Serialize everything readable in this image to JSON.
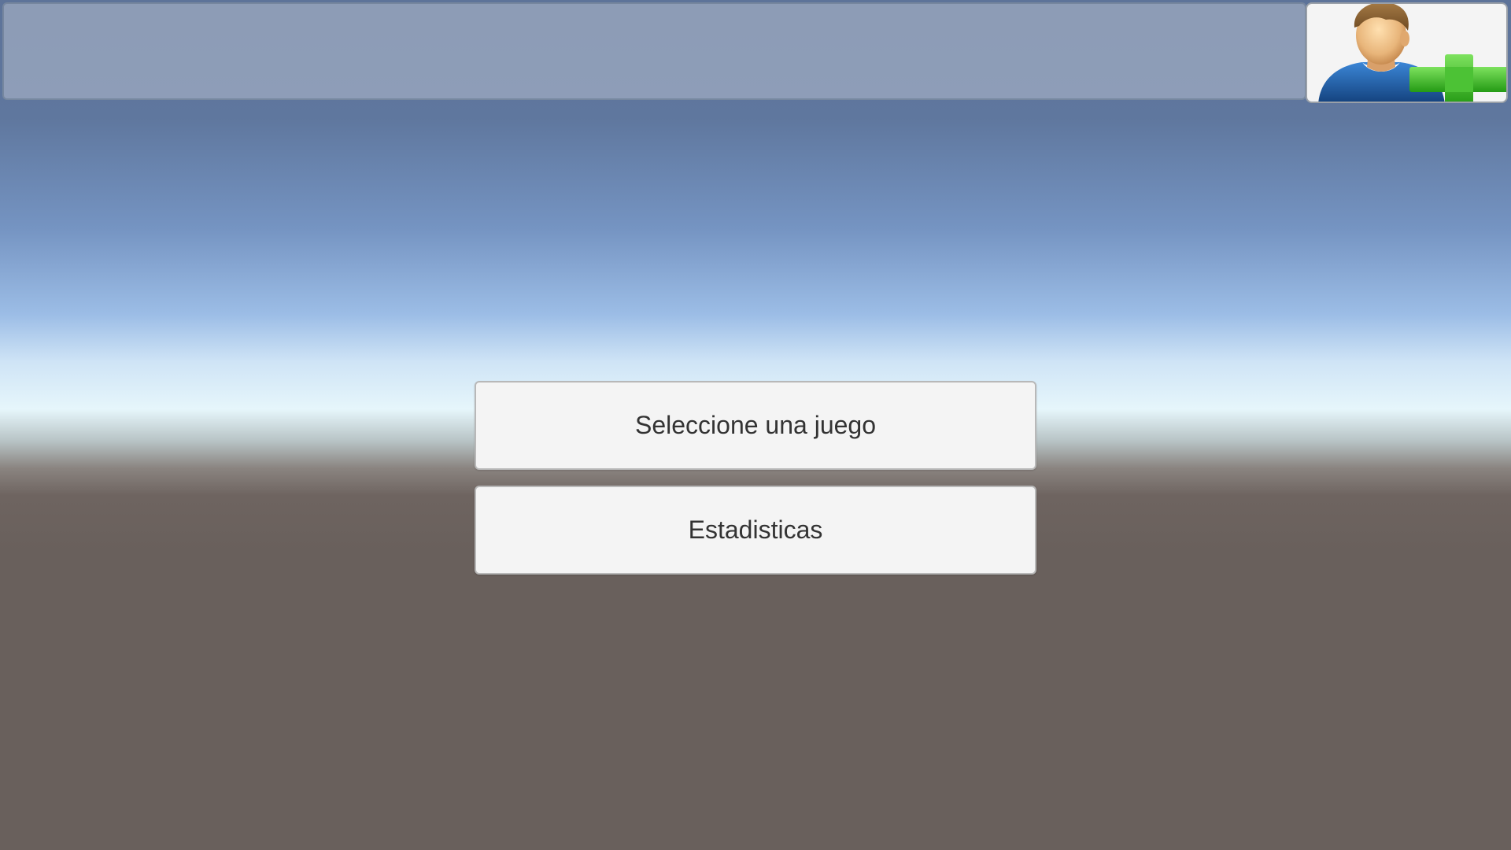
{
  "top_bar": {
    "add_user_icon": "user-add-icon"
  },
  "menu": {
    "select_game_label": "Seleccione una juego",
    "statistics_label": "Estadisticas"
  },
  "colors": {
    "button_bg": "#f4f4f4",
    "button_text": "#333333",
    "plus_green": "#3ec42b",
    "shirt_blue": "#1e63b0"
  }
}
